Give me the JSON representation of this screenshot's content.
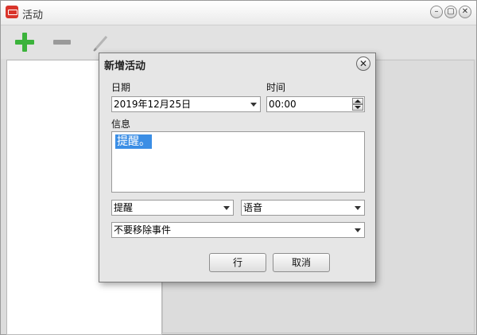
{
  "window": {
    "title": "活动",
    "minimize": "–",
    "maximize": "▢",
    "close": "✕"
  },
  "dialog": {
    "title": "新增活动",
    "close": "✕",
    "date_label": "日期",
    "date_value": "2019年12月25日",
    "time_label": "时间",
    "time_value": "00:00",
    "info_label": "信息",
    "info_value": "提醒。",
    "reminder_type": "提醒",
    "sound_type": "语音",
    "remove_option": "不要移除事件",
    "ok_label": "行",
    "cancel_label": "取消"
  },
  "colors": {
    "accent": "#3bb33b",
    "selection": "#3b8ee5",
    "app_icon": "#d9342b"
  }
}
